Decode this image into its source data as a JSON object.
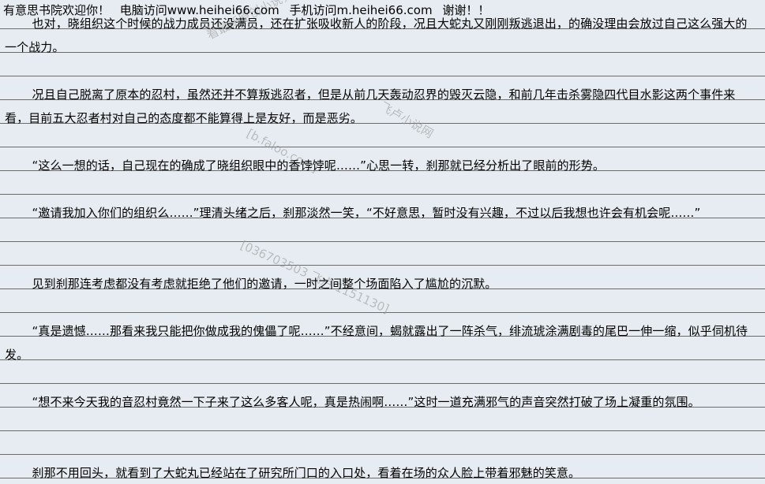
{
  "header": {
    "welcome": "有意思书院欢迎你！",
    "pc": "电脑访问www.heihei66.com",
    "mobile": "手机访问m.heihei66.com",
    "thanks": "谢谢！！"
  },
  "paragraphs": [
    "也对，晓组织这个时候的战力成员还没满员，还在扩张吸收新人的阶段，况且大蛇丸又刚刚叛逃退出，的确没理由会放过自己这么强大的一个战力。",
    "况且自己脱离了原本的忍村，虽然还并不算叛逃忍者，但是从前几天轰动忍界的毁灭云隐，和前几年击杀雾隐四代目水影这两个事件来看，目前五大忍者村对自己的态度都不能算得上是友好，而是恶劣。",
    "“这么一想的话，自己现在的确成了晓组织眼中的香饽饽呢……”心思一转，刹那就已经分析出了眼前的形势。",
    "“邀请我加入你们的组织么……”理清头绪之后，刹那淡然一笑，“不好意思，暂时没有兴趣，不过以后我想也许会有机会呢……”",
    "见到刹那连考虑都没有考虑就拒绝了他们的邀请，一时之间整个场面陷入了尴尬的沉默。",
    "“真是遗憾……那看来我只能把你做成我的傀儡了呢……”不经意间，蝎就露出了一阵杀气，绯流琥涂满剧毒的尾巴一伸一缩，似乎伺机待发。",
    "“想不来今天我的音忍村竟然一下子来了这么多客人呢，真是热闹啊……”这时一道充满邪气的声音突然打破了场上凝重的氛围。",
    "刹那不用回头，就看到了大蛇丸已经站在了研究所门口的入口处，看着在场的众人脸上带着邪魅的笑意。"
  ],
  "watermarks": {
    "w1": "看最新原创小说，请",
    "w2": "飞卢小说网",
    "w3": "[b.faloo.com]",
    "w4": "[036703503 飞卢 1151130]"
  }
}
